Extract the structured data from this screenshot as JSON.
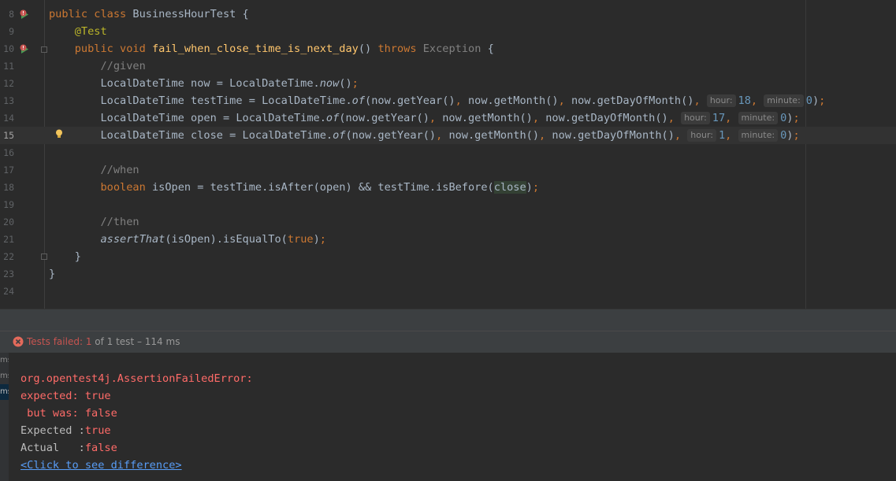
{
  "editor": {
    "lines": [
      {
        "n": "8",
        "tokens": [
          {
            "t": "public class ",
            "c": "kw"
          },
          {
            "t": "BusinessHourTest {",
            "c": ""
          }
        ]
      },
      {
        "n": "9",
        "tokens": [
          {
            "t": "    ",
            "c": ""
          },
          {
            "t": "@Test",
            "c": "ann"
          }
        ]
      },
      {
        "n": "10",
        "tokens": [
          {
            "t": "    ",
            "c": ""
          },
          {
            "t": "public void ",
            "c": "kw"
          },
          {
            "t": "fail_when_close_time_is_next_day",
            "c": "fn"
          },
          {
            "t": "() ",
            "c": ""
          },
          {
            "t": "throws ",
            "c": "kw"
          },
          {
            "t": "Exception",
            "c": "exc"
          },
          {
            "t": " {",
            "c": ""
          }
        ]
      },
      {
        "n": "11",
        "tokens": [
          {
            "t": "        //given",
            "c": "cmt"
          }
        ]
      },
      {
        "n": "12",
        "tokens": [
          {
            "t": "        LocalDateTime now = LocalDateTime.",
            "c": ""
          },
          {
            "t": "now",
            "c": "it"
          },
          {
            "t": "()",
            "c": ""
          },
          {
            "t": ";",
            "c": "kw"
          }
        ]
      },
      {
        "n": "13",
        "tokens": [
          {
            "t": "        LocalDateTime testTime = LocalDateTime.",
            "c": ""
          },
          {
            "t": "of",
            "c": "it"
          },
          {
            "t": "(now.getYear()",
            "c": ""
          },
          {
            "t": ", ",
            "c": "kw"
          },
          {
            "t": "now.getMonth()",
            "c": ""
          },
          {
            "t": ", ",
            "c": "kw"
          },
          {
            "t": "now.getDayOfMonth()",
            "c": ""
          },
          {
            "t": ", ",
            "c": "kw"
          },
          {
            "t": "hour:",
            "c": "hint"
          },
          {
            "t": "18",
            "c": "num"
          },
          {
            "t": ", ",
            "c": "kw"
          },
          {
            "t": "minute:",
            "c": "hint"
          },
          {
            "t": "0",
            "c": "num"
          },
          {
            "t": ")",
            "c": ""
          },
          {
            "t": ";",
            "c": "kw"
          }
        ]
      },
      {
        "n": "14",
        "tokens": [
          {
            "t": "        LocalDateTime open = LocalDateTime.",
            "c": ""
          },
          {
            "t": "of",
            "c": "it"
          },
          {
            "t": "(now.getYear()",
            "c": ""
          },
          {
            "t": ", ",
            "c": "kw"
          },
          {
            "t": "now.getMonth()",
            "c": ""
          },
          {
            "t": ", ",
            "c": "kw"
          },
          {
            "t": "now.getDayOfMonth()",
            "c": ""
          },
          {
            "t": ", ",
            "c": "kw"
          },
          {
            "t": "hour:",
            "c": "hint"
          },
          {
            "t": "17",
            "c": "num"
          },
          {
            "t": ", ",
            "c": "kw"
          },
          {
            "t": "minute:",
            "c": "hint"
          },
          {
            "t": "0",
            "c": "num"
          },
          {
            "t": ")",
            "c": ""
          },
          {
            "t": ";",
            "c": "kw"
          }
        ]
      },
      {
        "n": "15",
        "current": true,
        "tokens": [
          {
            "t": "        LocalDateTime close = LocalDateTime.",
            "c": ""
          },
          {
            "t": "of",
            "c": "it"
          },
          {
            "t": "(now.getYear()",
            "c": ""
          },
          {
            "t": ", ",
            "c": "kw"
          },
          {
            "t": "now.getMonth()",
            "c": ""
          },
          {
            "t": ", ",
            "c": "kw"
          },
          {
            "t": "now.getDayOfMonth()",
            "c": ""
          },
          {
            "t": ", ",
            "c": "kw"
          },
          {
            "t": "hour:",
            "c": "hint"
          },
          {
            "t": "1",
            "c": "num"
          },
          {
            "t": ", ",
            "c": "kw"
          },
          {
            "t": "minute:",
            "c": "hint"
          },
          {
            "t": "0",
            "c": "num"
          },
          {
            "t": ")",
            "c": ""
          },
          {
            "t": ";",
            "c": "kw"
          }
        ]
      },
      {
        "n": "16",
        "tokens": []
      },
      {
        "n": "17",
        "tokens": [
          {
            "t": "        //when",
            "c": "cmt"
          }
        ]
      },
      {
        "n": "18",
        "tokens": [
          {
            "t": "        ",
            "c": ""
          },
          {
            "t": "boolean ",
            "c": "kw"
          },
          {
            "t": "isOpen = testTime.isAfter(open) && testTime.isBefore(",
            "c": ""
          },
          {
            "t": "close",
            "c": "hl"
          },
          {
            "t": ")",
            "c": ""
          },
          {
            "t": ";",
            "c": "kw"
          }
        ]
      },
      {
        "n": "19",
        "tokens": []
      },
      {
        "n": "20",
        "tokens": [
          {
            "t": "        //then",
            "c": "cmt"
          }
        ]
      },
      {
        "n": "21",
        "tokens": [
          {
            "t": "        ",
            "c": ""
          },
          {
            "t": "assertThat",
            "c": "it"
          },
          {
            "t": "(isOpen).isEqualTo(",
            "c": ""
          },
          {
            "t": "true",
            "c": "kw"
          },
          {
            "t": ")",
            "c": ""
          },
          {
            "t": ";",
            "c": "kw"
          }
        ]
      },
      {
        "n": "22",
        "tokens": [
          {
            "t": "    }",
            "c": ""
          }
        ]
      },
      {
        "n": "23",
        "tokens": [
          {
            "t": "}",
            "c": ""
          }
        ]
      },
      {
        "n": "24",
        "tokens": []
      }
    ]
  },
  "status": {
    "failed_label": "Tests failed: ",
    "failed_count": "1",
    "of_total": " of 1 test",
    "duration": " – 114 ms"
  },
  "console": {
    "side_labels": [
      "ms",
      "ms",
      "ms"
    ],
    "lines": [
      {
        "text": "org.opentest4j.AssertionFailedError:",
        "kind": "err"
      },
      {
        "text": "expected: true",
        "kind": "err"
      },
      {
        "text": " but was: false",
        "kind": "err"
      },
      {
        "expected_label": "Expected :",
        "expected_value": "true"
      },
      {
        "actual_label": "Actual   :",
        "actual_value": "false"
      },
      {
        "text": "<Click to see difference>",
        "kind": "link"
      }
    ]
  },
  "colors": {
    "background": "#2b2b2b",
    "keyword": "#cc7832",
    "method": "#ffc66d",
    "annotation": "#bbb529",
    "comment": "#808080",
    "number": "#6897bb",
    "error": "#ff6b68",
    "link": "#589df6"
  }
}
